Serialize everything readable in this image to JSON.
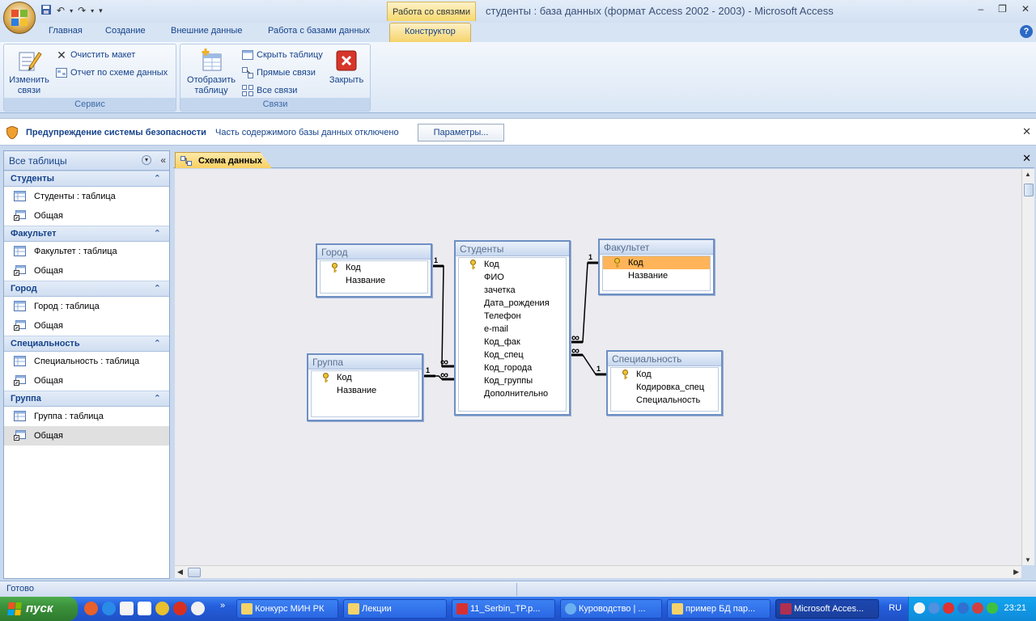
{
  "window": {
    "title": "студенты : база данных (формат Access 2002 - 2003) - Microsoft Access",
    "context_tab_group": "Работа со связями"
  },
  "ribbon_tabs": [
    "Главная",
    "Создание",
    "Внешние данные",
    "Работа с базами данных",
    "Конструктор"
  ],
  "ribbon": {
    "service": {
      "label": "Сервис",
      "edit_relations": "Изменить связи",
      "clear_layout": "Очистить макет",
      "relation_report": "Отчет по схеме данных"
    },
    "relations": {
      "label": "Связи",
      "show_table": "Отобразить таблицу",
      "hide_table": "Скрыть таблицу",
      "direct_relations": "Прямые связи",
      "all_relations": "Все связи",
      "close": "Закрыть"
    }
  },
  "security_bar": {
    "title": "Предупреждение системы безопасности",
    "text": "Часть содержимого базы данных отключено",
    "button": "Параметры..."
  },
  "nav": {
    "header": "Все таблицы",
    "groups": [
      {
        "name": "Студенты",
        "items": [
          "Студенты : таблица",
          "Общая"
        ]
      },
      {
        "name": "Факультет",
        "items": [
          "Факультет : таблица",
          "Общая"
        ]
      },
      {
        "name": "Город",
        "items": [
          "Город : таблица",
          "Общая"
        ]
      },
      {
        "name": "Специальность",
        "items": [
          "Специальность : таблица",
          "Общая"
        ]
      },
      {
        "name": "Группа",
        "items": [
          "Группа : таблица",
          "Общая"
        ]
      }
    ]
  },
  "document_tab": "Схема данных",
  "diagram": {
    "tables": {
      "gorod": {
        "title": "Город",
        "fields": [
          "Код",
          "Название"
        ]
      },
      "studenty": {
        "title": "Студенты",
        "fields": [
          "Код",
          "ФИО",
          "зачетка",
          "Дата_рождения",
          "Телефон",
          "e-mail",
          "Код_фак",
          "Код_спец",
          "Код_города",
          "Код_группы",
          "Дополнительно"
        ]
      },
      "fakultet": {
        "title": "Факультет",
        "fields": [
          "Код",
          "Название"
        ]
      },
      "gruppa": {
        "title": "Группа",
        "fields": [
          "Код",
          "Название"
        ]
      },
      "specialnost": {
        "title": "Специальность",
        "fields": [
          "Код",
          "Кодировка_спец",
          "Специальность"
        ]
      }
    },
    "one_label": "1",
    "many_label": "∞"
  },
  "status": "Готово",
  "taskbar": {
    "start": "пуск",
    "buttons": [
      "Конкурс МИН РК",
      "Лекции",
      "11_Serbin_TP.p...",
      "Куроводство | ...",
      "пример БД пар...",
      "Microsoft Acces..."
    ],
    "lang": "RU",
    "clock": "23:21"
  }
}
